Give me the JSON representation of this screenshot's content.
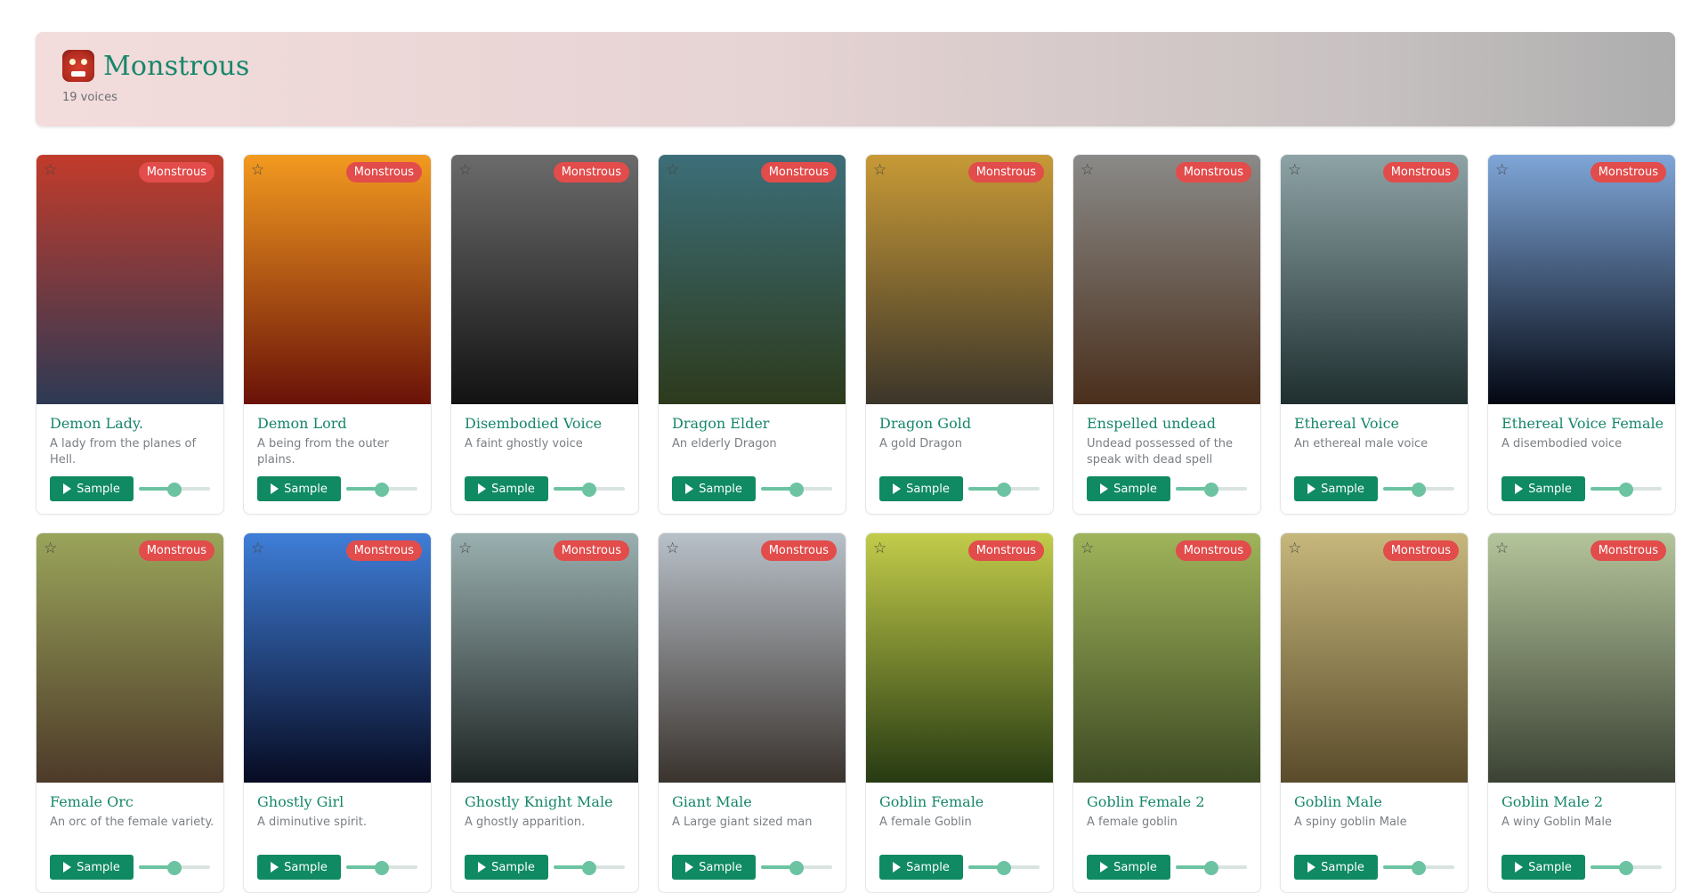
{
  "header": {
    "title": "Monstrous",
    "subtitle": "19 voices",
    "icon": "ogre-icon",
    "gradient_colors": [
      "#f3dcdc",
      "#adadad"
    ]
  },
  "colors": {
    "accent": "#16866a",
    "button": "#0f8a62",
    "badge": "#e24c4b",
    "slider": "#6cc3a1"
  },
  "voices": [
    {
      "name": "Demon Lady.",
      "description": "A lady from the planes of Hell.",
      "tag": "Monstrous",
      "sample_label": "Sample",
      "volume": 0.5,
      "bg": [
        "#c23b2b",
        "#2d3a54"
      ]
    },
    {
      "name": "Demon Lord",
      "description": "A being from the outer plains.",
      "tag": "Monstrous",
      "sample_label": "Sample",
      "volume": 0.5,
      "bg": [
        "#f39a20",
        "#6a1208"
      ]
    },
    {
      "name": "Disembodied Voice",
      "description": "A faint ghostly voice",
      "tag": "Monstrous",
      "sample_label": "Sample",
      "volume": 0.5,
      "bg": [
        "#6b6b6b",
        "#121212"
      ]
    },
    {
      "name": "Dragon Elder",
      "description": "An elderly Dragon",
      "tag": "Monstrous",
      "sample_label": "Sample",
      "volume": 0.5,
      "bg": [
        "#3c6e78",
        "#2d3a1c"
      ]
    },
    {
      "name": "Dragon Gold",
      "description": "A gold Dragon",
      "tag": "Monstrous",
      "sample_label": "Sample",
      "volume": 0.5,
      "bg": [
        "#c89a36",
        "#3b352a"
      ]
    },
    {
      "name": "Enspelled undead",
      "description": "Undead possessed of the speak with dead spell",
      "tag": "Monstrous",
      "sample_label": "Sample",
      "volume": 0.5,
      "bg": [
        "#8a8a88",
        "#4a2f1c"
      ]
    },
    {
      "name": "Ethereal Voice",
      "description": "An ethereal male voice",
      "tag": "Monstrous",
      "sample_label": "Sample",
      "volume": 0.5,
      "bg": [
        "#8ea3a6",
        "#1f2f30"
      ]
    },
    {
      "name": "Ethereal Voice Female",
      "description": "A disembodied voice",
      "tag": "Monstrous",
      "sample_label": "Sample",
      "volume": 0.5,
      "bg": [
        "#7fa6d8",
        "#030712"
      ]
    },
    {
      "name": "Female Orc",
      "description": "An orc of the female variety.",
      "tag": "Monstrous",
      "sample_label": "Sample",
      "volume": 0.5,
      "bg": [
        "#9aa45a",
        "#4d3a29"
      ]
    },
    {
      "name": "Ghostly Girl",
      "description": "A diminutive spirit.",
      "tag": "Monstrous",
      "sample_label": "Sample",
      "volume": 0.5,
      "bg": [
        "#3f7ed8",
        "#070b22"
      ]
    },
    {
      "name": "Ghostly Knight Male",
      "description": "A ghostly apparition.",
      "tag": "Monstrous",
      "sample_label": "Sample",
      "volume": 0.5,
      "bg": [
        "#9ab0b0",
        "#1d2423"
      ]
    },
    {
      "name": "Giant Male",
      "description": "A Large giant sized man",
      "tag": "Monstrous",
      "sample_label": "Sample",
      "volume": 0.5,
      "bg": [
        "#b8c0c8",
        "#3a332e"
      ]
    },
    {
      "name": "Goblin Female",
      "description": "A female Goblin",
      "tag": "Monstrous",
      "sample_label": "Sample",
      "volume": 0.5,
      "bg": [
        "#c2cc4a",
        "#273a12"
      ]
    },
    {
      "name": "Goblin Female 2",
      "description": "A female goblin",
      "tag": "Monstrous",
      "sample_label": "Sample",
      "volume": 0.5,
      "bg": [
        "#9fb45a",
        "#3d4a23"
      ]
    },
    {
      "name": "Goblin Male",
      "description": "A spiny goblin Male",
      "tag": "Monstrous",
      "sample_label": "Sample",
      "volume": 0.5,
      "bg": [
        "#c6b77c",
        "#5a4b2b"
      ]
    },
    {
      "name": "Goblin Male 2",
      "description": "A winy Goblin Male",
      "tag": "Monstrous",
      "sample_label": "Sample",
      "volume": 0.5,
      "bg": [
        "#b4c49a",
        "#3b4234"
      ]
    }
  ]
}
